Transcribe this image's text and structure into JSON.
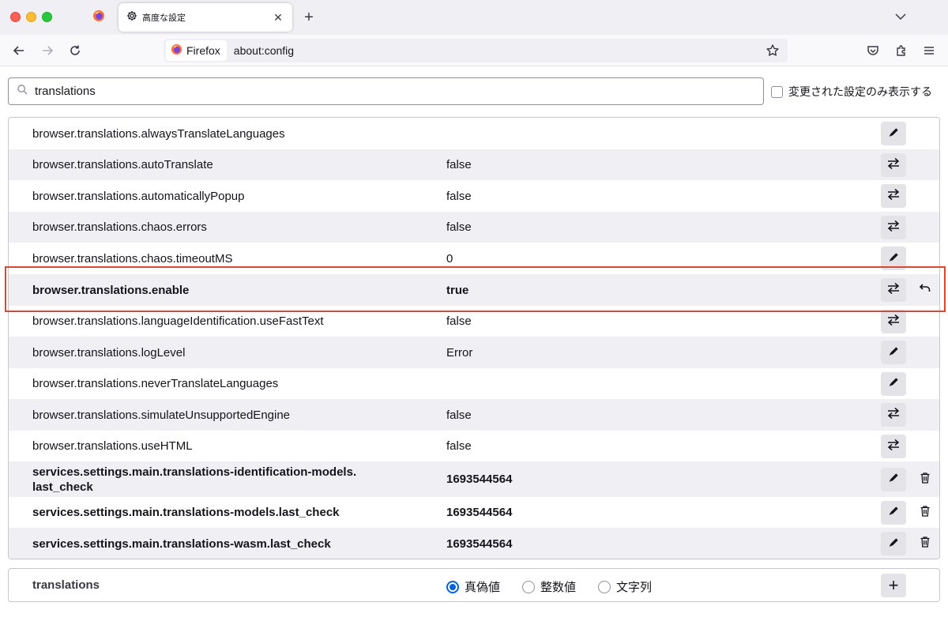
{
  "browser": {
    "tab_title": "高度な設定",
    "identity_label": "Firefox",
    "url": "about:config"
  },
  "search": {
    "value": "translations",
    "modified_only_label": "変更された設定のみ表示する"
  },
  "prefs": [
    {
      "name": "browser.translations.alwaysTranslateLanguages",
      "value": "",
      "action": "edit",
      "modified": false
    },
    {
      "name": "browser.translations.autoTranslate",
      "value": "false",
      "action": "toggle",
      "modified": false
    },
    {
      "name": "browser.translations.automaticallyPopup",
      "value": "false",
      "action": "toggle",
      "modified": false
    },
    {
      "name": "browser.translations.chaos.errors",
      "value": "false",
      "action": "toggle",
      "modified": false
    },
    {
      "name": "browser.translations.chaos.timeoutMS",
      "value": "0",
      "action": "edit",
      "modified": false
    },
    {
      "name": "browser.translations.enable",
      "value": "true",
      "action": "toggle",
      "modified": true,
      "secondary": "reset",
      "highlighted": true
    },
    {
      "name": "browser.translations.languageIdentification.useFastText",
      "value": "false",
      "action": "toggle",
      "modified": false
    },
    {
      "name": "browser.translations.logLevel",
      "value": "Error",
      "action": "edit",
      "modified": false
    },
    {
      "name": "browser.translations.neverTranslateLanguages",
      "value": "",
      "action": "edit",
      "modified": false
    },
    {
      "name": "browser.translations.simulateUnsupportedEngine",
      "value": "false",
      "action": "toggle",
      "modified": false
    },
    {
      "name": "browser.translations.useHTML",
      "value": "false",
      "action": "toggle",
      "modified": false
    },
    {
      "name": "services.settings.main.translations-identification-models.\nlast_check",
      "value": "1693544564",
      "action": "edit",
      "modified": true,
      "secondary": "delete"
    },
    {
      "name": "services.settings.main.translations-models.last_check",
      "value": "1693544564",
      "action": "edit",
      "modified": true,
      "secondary": "delete"
    },
    {
      "name": "services.settings.main.translations-wasm.last_check",
      "value": "1693544564",
      "action": "edit",
      "modified": true,
      "secondary": "delete"
    }
  ],
  "add_row": {
    "name": "translations",
    "types": [
      {
        "label": "真偽値",
        "checked": true
      },
      {
        "label": "整数値",
        "checked": false
      },
      {
        "label": "文字列",
        "checked": false
      }
    ]
  },
  "colors": {
    "highlight_box": "#e0452a",
    "radio_accent": "#0061e0"
  }
}
